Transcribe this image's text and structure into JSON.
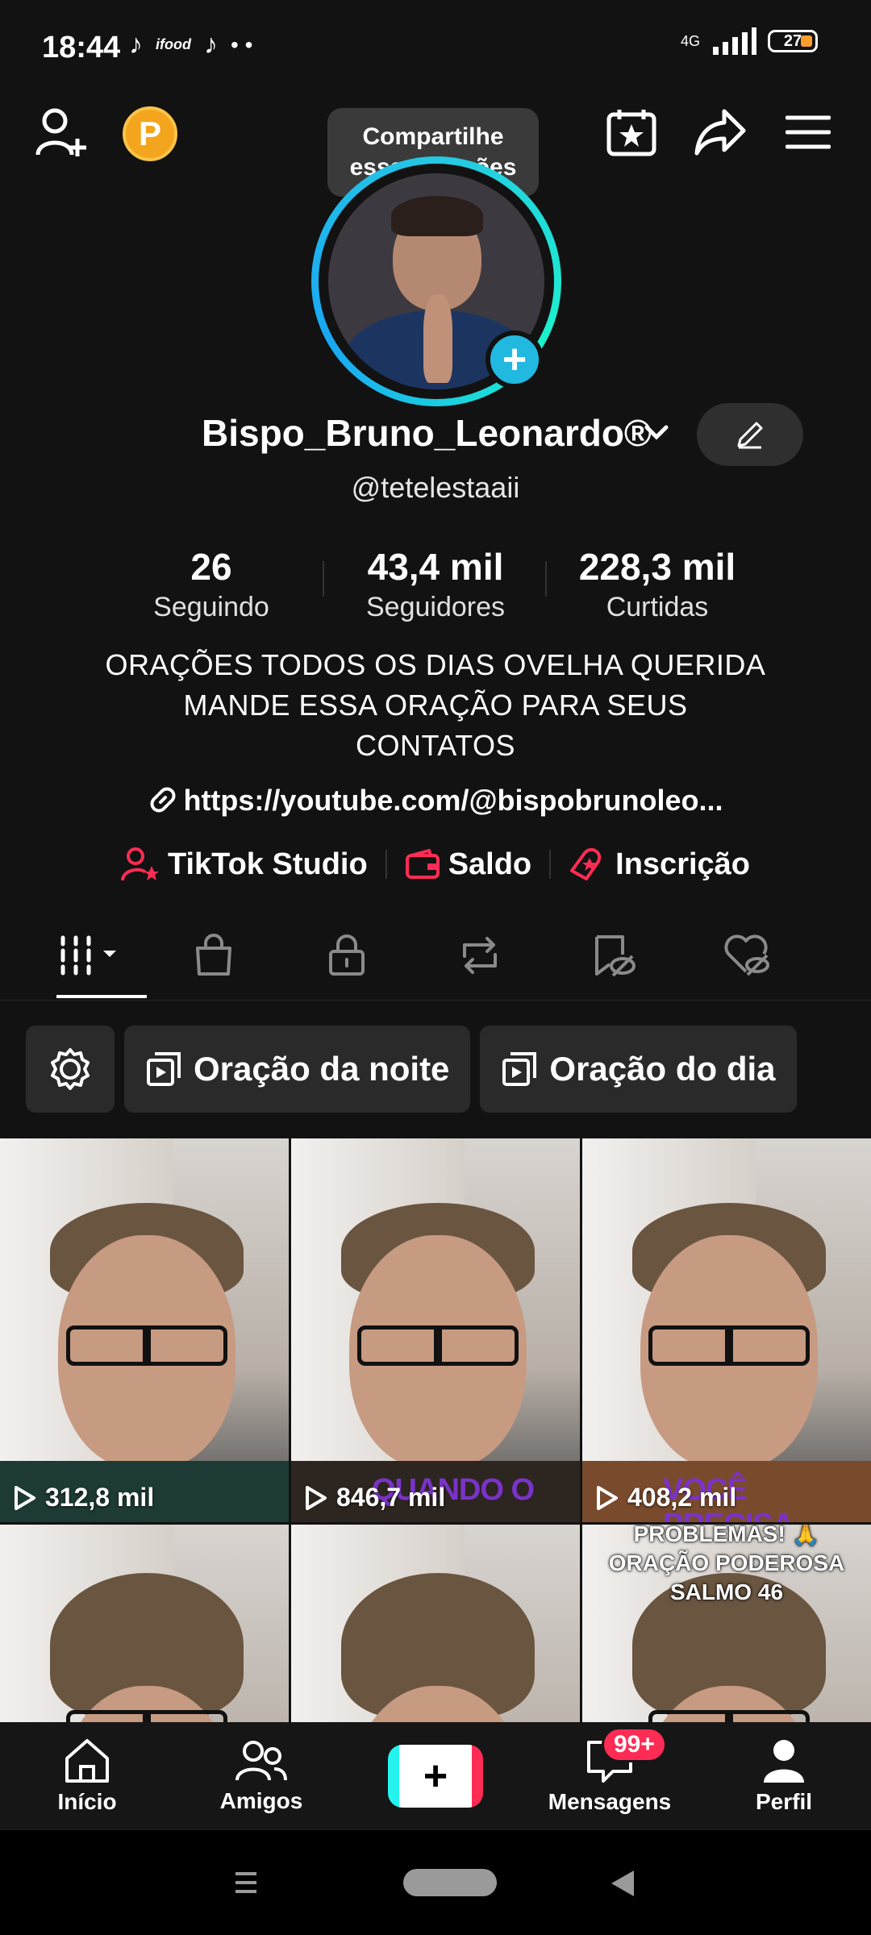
{
  "status": {
    "time": "18:44",
    "app_labels": [
      "ifood"
    ],
    "network": "4G",
    "battery": "27"
  },
  "header": {
    "tooltip_line1": "Compartilhe",
    "tooltip_line2": "essas orações",
    "coin_letter": "P"
  },
  "profile": {
    "name": "Bispo_Bruno_Leonardo®",
    "handle": "@tetelestaaii",
    "stats": [
      {
        "value": "26",
        "label": "Seguindo"
      },
      {
        "value": "43,4 mil",
        "label": "Seguidores"
      },
      {
        "value": "228,3 mil",
        "label": "Curtidas"
      }
    ],
    "bio": [
      "ORAÇÕES TODOS OS DIAS OVELHA QUERIDA",
      "MANDE ESSA ORAÇÃO PARA SEUS",
      "CONTATOS"
    ],
    "link": "https://youtube.com/@bispobrunoleo...",
    "tools": [
      {
        "label": "TikTok Studio",
        "icon": "person-star-icon"
      },
      {
        "label": "Saldo",
        "icon": "wallet-icon"
      },
      {
        "label": "Inscrição",
        "icon": "subscription-icon"
      }
    ]
  },
  "tabs": [
    "videos-grid-icon",
    "shop-bag-icon",
    "lock-icon",
    "repost-icon",
    "favorites-hidden-icon",
    "liked-hidden-icon"
  ],
  "playlists": [
    {
      "label": "Oração da noite"
    },
    {
      "label": "Oração do dia"
    }
  ],
  "videos": [
    {
      "views": "312,8 mil",
      "overlay": ""
    },
    {
      "views": "846,7 mil",
      "overlay": "QUANDO O"
    },
    {
      "views": "408,2 mil",
      "overlay": "VOCÊ PRECISA"
    },
    {
      "views": "",
      "overlay": ""
    },
    {
      "views": "",
      "overlay": ""
    },
    {
      "views": "",
      "overlay": "",
      "caption_lines": [
        "PROBLEMAS! 🙏",
        "ORAÇÃO PODEROSA",
        "SALMO 46"
      ]
    }
  ],
  "bottom_nav": {
    "home": "Início",
    "friends": "Amigos",
    "create": "+",
    "messages": "Mensagens",
    "messages_badge": "99+",
    "profile": "Perfil"
  },
  "colors": {
    "accent_red": "#fe2c55",
    "ring_cyan": "#25c8e3",
    "coin": "#f3a51d",
    "background": "#121212"
  }
}
